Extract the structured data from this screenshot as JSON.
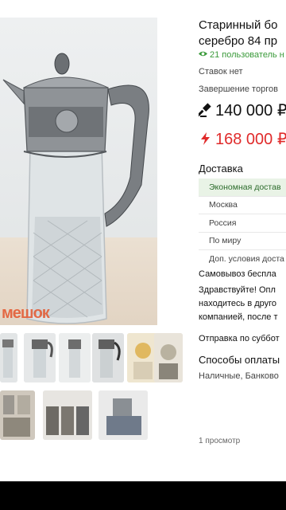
{
  "listing": {
    "title_line1": "Старинный бо",
    "title_line2": "серебро 84 пр",
    "watchers": "21 пользователь н",
    "bids": "Ставок нет",
    "auction_end_label": "Завершение торгов",
    "bid_price": "140 000 ₽",
    "buy_now_price": "168 000 ₽",
    "views": "1 просмотр"
  },
  "delivery": {
    "heading": "Доставка",
    "options": [
      "Экономная достав",
      "Москва",
      "Россия",
      "По миру",
      "Доп. условия доста"
    ],
    "pickup": "Самовывоз беспла",
    "note_line1": "Здравствуйте! Опл",
    "note_line2": "находитесь в друго",
    "note_line3": "компанией, после т",
    "shipping_day": "Отправка по суббот"
  },
  "payment": {
    "heading": "Способы оплаты",
    "methods": "Наличные, Банково"
  },
  "gallery": {
    "watermark": "мешок"
  },
  "colors": {
    "green": "#3a9a3a",
    "red": "#e02b2b",
    "text": "#111111",
    "muted": "#444444"
  }
}
